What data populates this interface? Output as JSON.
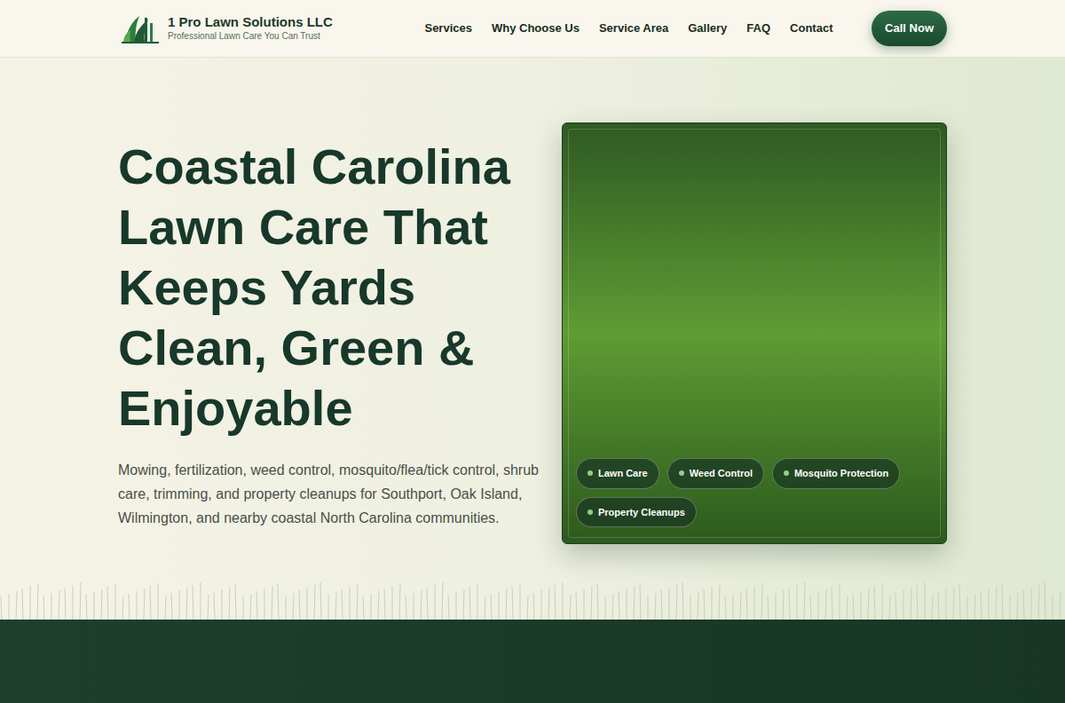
{
  "header": {
    "brand": {
      "name": "1 Pro Lawn Solutions LLC",
      "tagline": "Professional Lawn Care You Can Trust"
    },
    "nav": [
      "Services",
      "Why Choose Us",
      "Service Area",
      "Gallery",
      "FAQ",
      "Contact"
    ],
    "cta": "Call Now"
  },
  "hero": {
    "heading": "Coastal Carolina Lawn Care That Keeps Yards Clean, Green & Enjoyable",
    "description": "Mowing, fertilization, weed control, mosquito/flea/tick control, shrub care, trimming, and property cleanups for Southport, Oak Island, Wilmington, and nearby coastal North Carolina communities.",
    "image_tags": [
      "Lawn Care",
      "Weed Control",
      "Mosquito Protection",
      "Property Cleanups"
    ]
  }
}
